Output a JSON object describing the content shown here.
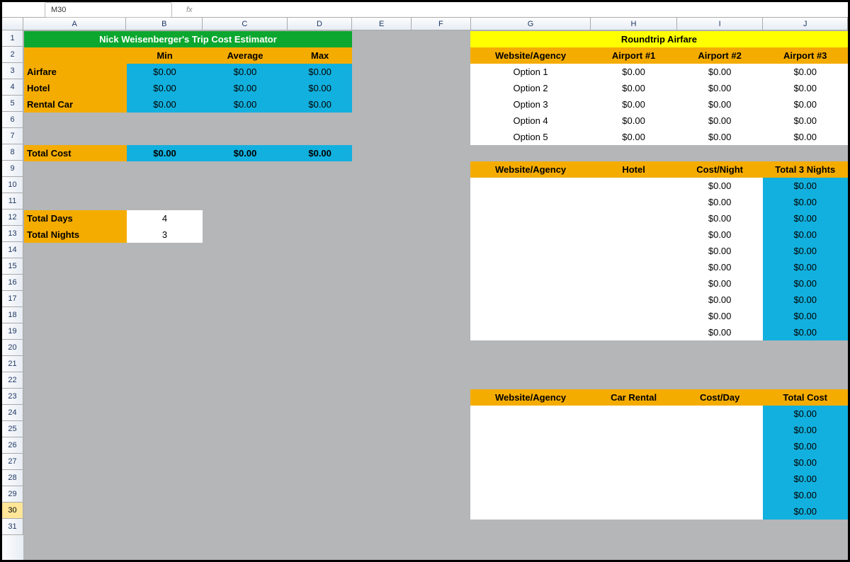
{
  "namebox": "M30",
  "columns": [
    "A",
    "B",
    "C",
    "D",
    "E",
    "F",
    "G",
    "H",
    "I",
    "J"
  ],
  "rows": [
    "1",
    "2",
    "3",
    "4",
    "5",
    "6",
    "7",
    "8",
    "9",
    "10",
    "11",
    "12",
    "13",
    "14",
    "15",
    "16",
    "17",
    "18",
    "19",
    "20",
    "21",
    "22",
    "23",
    "24",
    "25",
    "26",
    "27",
    "28",
    "29",
    "30",
    "31"
  ],
  "selected_row": "30",
  "estimator": {
    "title": "Nick Weisenberger's Trip Cost Estimator",
    "headers": {
      "min": "Min",
      "avg": "Average",
      "max": "Max"
    },
    "rows": [
      {
        "label": "Airfare",
        "min": "$0.00",
        "avg": "$0.00",
        "max": "$0.00"
      },
      {
        "label": "Hotel",
        "min": "$0.00",
        "avg": "$0.00",
        "max": "$0.00"
      },
      {
        "label": "Rental Car",
        "min": "$0.00",
        "avg": "$0.00",
        "max": "$0.00"
      }
    ],
    "total_label": "Total Cost",
    "total": {
      "min": "$0.00",
      "avg": "$0.00",
      "max": "$0.00"
    },
    "days_label": "Total Days",
    "days": "4",
    "nights_label": "Total Nights",
    "nights": "3"
  },
  "airfare": {
    "title": "Roundtrip Airfare",
    "headers": {
      "agency": "Website/Agency",
      "a1": "Airport #1",
      "a2": "Airport #2",
      "a3": "Airport #3"
    },
    "rows": [
      {
        "agency": "Option 1",
        "a1": "$0.00",
        "a2": "$0.00",
        "a3": "$0.00"
      },
      {
        "agency": "Option 2",
        "a1": "$0.00",
        "a2": "$0.00",
        "a3": "$0.00"
      },
      {
        "agency": "Option 3",
        "a1": "$0.00",
        "a2": "$0.00",
        "a3": "$0.00"
      },
      {
        "agency": "Option 4",
        "a1": "$0.00",
        "a2": "$0.00",
        "a3": "$0.00"
      },
      {
        "agency": "Option 5",
        "a1": "$0.00",
        "a2": "$0.00",
        "a3": "$0.00"
      }
    ]
  },
  "hotel": {
    "headers": {
      "agency": "Website/Agency",
      "hotel": "Hotel",
      "costnight": "Cost/Night",
      "total": "Total 3 Nights"
    },
    "rows": [
      {
        "cost": "$0.00",
        "total": "$0.00"
      },
      {
        "cost": "$0.00",
        "total": "$0.00"
      },
      {
        "cost": "$0.00",
        "total": "$0.00"
      },
      {
        "cost": "$0.00",
        "total": "$0.00"
      },
      {
        "cost": "$0.00",
        "total": "$0.00"
      },
      {
        "cost": "$0.00",
        "total": "$0.00"
      },
      {
        "cost": "$0.00",
        "total": "$0.00"
      },
      {
        "cost": "$0.00",
        "total": "$0.00"
      },
      {
        "cost": "$0.00",
        "total": "$0.00"
      },
      {
        "cost": "$0.00",
        "total": "$0.00"
      }
    ]
  },
  "car": {
    "headers": {
      "agency": "Website/Agency",
      "car": "Car Rental",
      "costday": "Cost/Day",
      "total": "Total Cost"
    },
    "rows": [
      {
        "total": "$0.00"
      },
      {
        "total": "$0.00"
      },
      {
        "total": "$0.00"
      },
      {
        "total": "$0.00"
      },
      {
        "total": "$0.00"
      },
      {
        "total": "$0.00"
      },
      {
        "total": "$0.00"
      }
    ]
  }
}
